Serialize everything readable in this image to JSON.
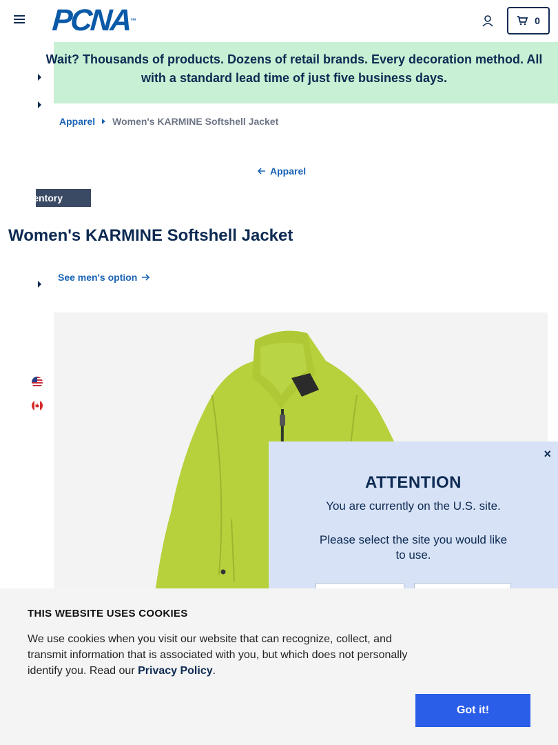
{
  "header": {
    "logo_text": "PCNA",
    "logo_tm": "™",
    "cart_count": "0"
  },
  "promo": {
    "text": "Wait? Thousands of products. Dozens of retail brands. Every decoration method. All with a standard lead time of just five business days."
  },
  "breadcrumb": {
    "parent": "Apparel",
    "current": "Women's KARMINE Softshell Jacket"
  },
  "back_link": "Apparel",
  "inventory_badge": "Inventory",
  "product": {
    "title": "Women's KARMINE Softshell Jacket",
    "mens_option": "See men's option",
    "jacket_color": "#b6d13c"
  },
  "modal": {
    "close": "×",
    "title": "ATTENTION",
    "line1": "You are currently on the U.S. site.",
    "line2": "Please select the site you would like to use."
  },
  "cookie": {
    "title": "THIS WEBSITE USES COOKIES",
    "text": "We use cookies when you visit our website that can recognize, collect, and transmit information that is associated with you, but which does not personally identify you. Read our ",
    "link": "Privacy Policy",
    "period": ".",
    "button": "Got it!"
  },
  "colors": {
    "navy": "#0d2a52",
    "link_blue": "#1a63b5",
    "promo_green": "#c8f0d4",
    "cookie_button": "#2a5de8"
  }
}
